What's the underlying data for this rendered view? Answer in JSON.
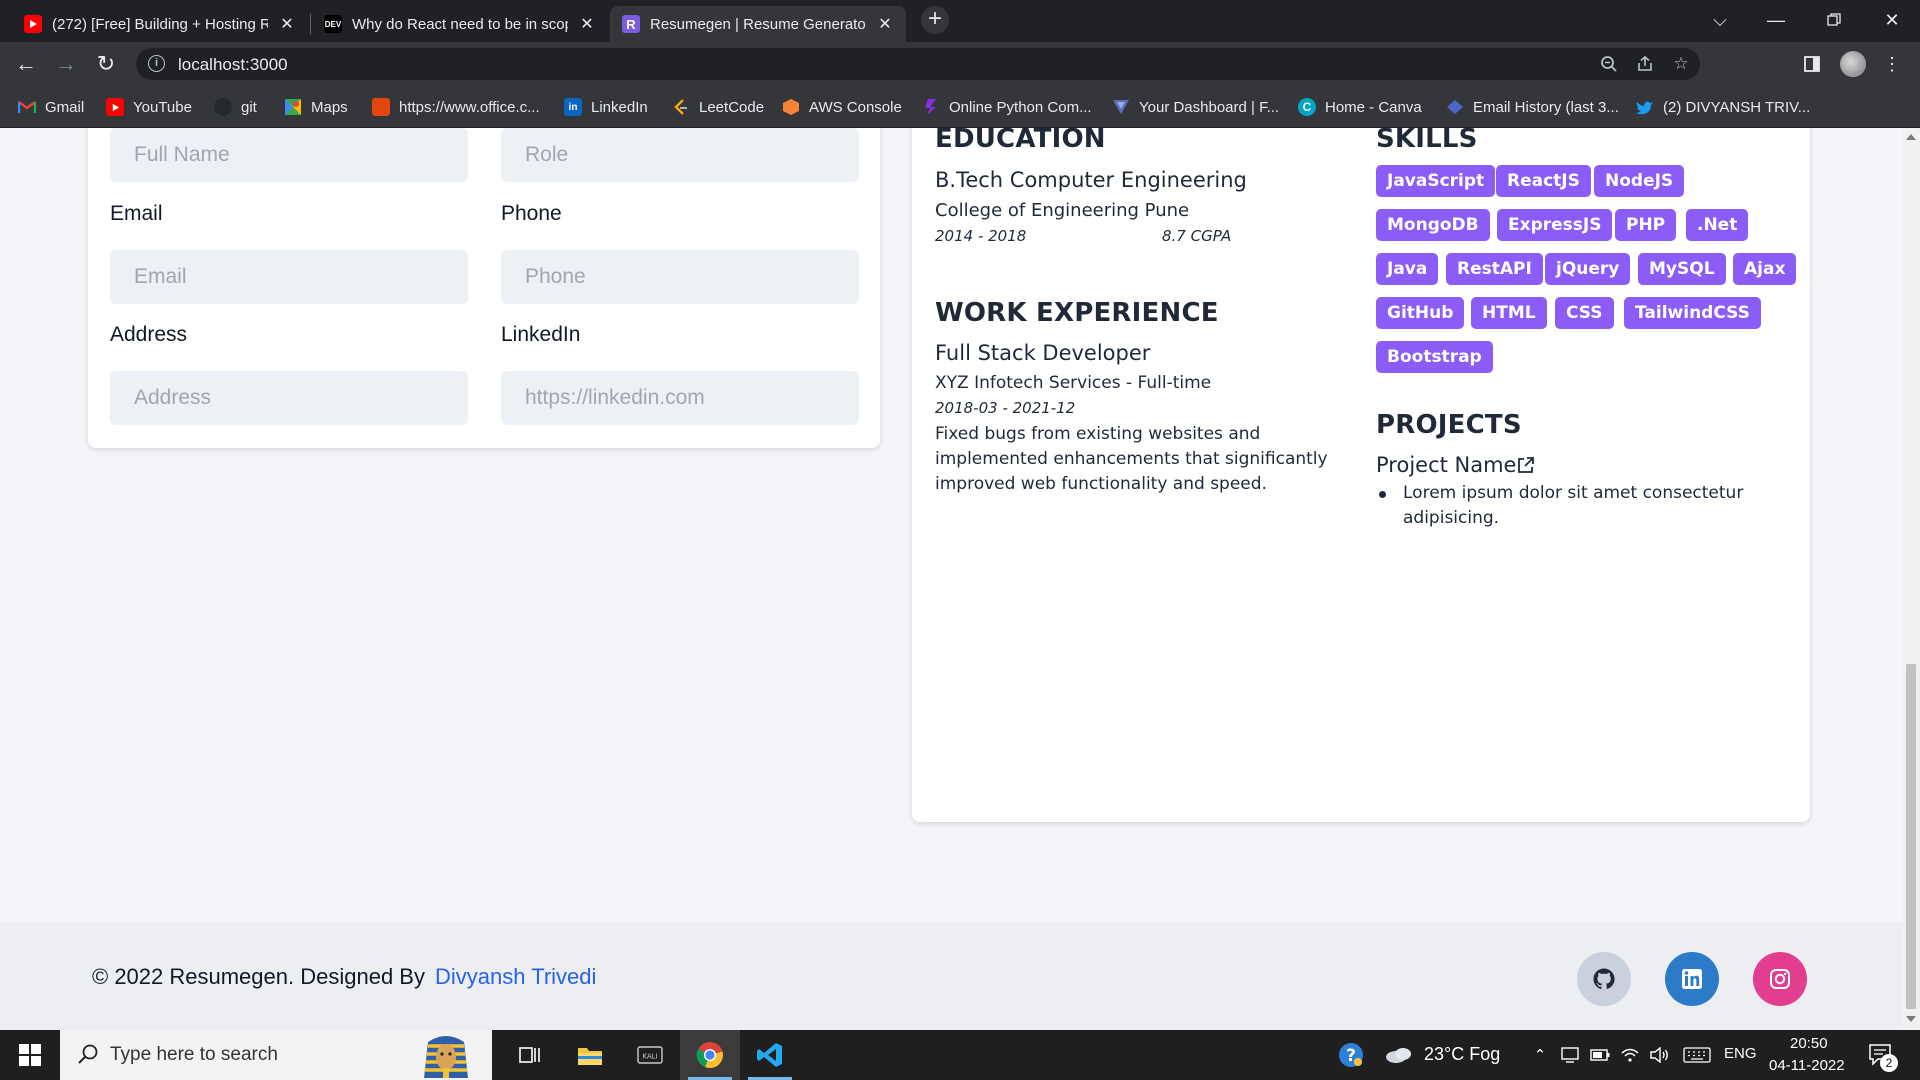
{
  "browser": {
    "tabs": [
      {
        "title": "(272) [Free] Building + Hosting R",
        "icon": "youtube-icon"
      },
      {
        "title": "Why do React need to be in scop",
        "icon": "dev-icon"
      },
      {
        "title": "Resumegen | Resume Generator",
        "icon": "resumegen-icon"
      }
    ],
    "url": "localhost:3000",
    "bookmarks": [
      {
        "label": "Gmail",
        "icon": "gmail-icon"
      },
      {
        "label": "YouTube",
        "icon": "youtube-icon"
      },
      {
        "label": "git",
        "icon": "github-icon"
      },
      {
        "label": "Maps",
        "icon": "maps-icon"
      },
      {
        "label": "https://www.office.c...",
        "icon": "office-icon"
      },
      {
        "label": "LinkedIn",
        "icon": "linkedin-icon"
      },
      {
        "label": "LeetCode",
        "icon": "leetcode-icon"
      },
      {
        "label": "AWS Console",
        "icon": "aws-icon"
      },
      {
        "label": "Online Python Com...",
        "icon": "python-icon"
      },
      {
        "label": "Your Dashboard | F...",
        "icon": "dashboard-icon"
      },
      {
        "label": "Home - Canva",
        "icon": "canva-icon"
      },
      {
        "label": "Email History (last 3...",
        "icon": "email-icon"
      },
      {
        "label": "(2) DIVYANSH TRIV...",
        "icon": "twitter-icon"
      }
    ]
  },
  "form": {
    "fullname_placeholder": "Full Name",
    "role_placeholder": "Role",
    "email_label": "Email",
    "email_placeholder": "Email",
    "phone_label": "Phone",
    "phone_placeholder": "Phone",
    "address_label": "Address",
    "address_placeholder": "Address",
    "linkedin_label": "LinkedIn",
    "linkedin_placeholder": "https://linkedin.com"
  },
  "resume": {
    "education": {
      "title": "EDUCATION",
      "degree": "B.Tech Computer Engineering",
      "college": "College of Engineering Pune",
      "years": "2014 - 2018",
      "grade": "8.7 CGPA"
    },
    "experience": {
      "title": "WORK EXPERIENCE",
      "role": "Full Stack Developer",
      "company": "XYZ Infotech Services - Full-time",
      "period": "2018-03 - 2021-12",
      "description_lines": [
        "Fixed bugs from existing websites and",
        "implemented enhancements that significantly",
        "improved web functionality and speed."
      ]
    },
    "skills": {
      "title": "SKILLS",
      "items": [
        "JavaScript",
        "ReactJS",
        "NodeJS",
        "MongoDB",
        "ExpressJS",
        "PHP",
        ".Net",
        "Java",
        "RestAPI",
        "jQuery",
        "MySQL",
        "Ajax",
        "GitHub",
        "HTML",
        "CSS",
        "TailwindCSS",
        "Bootstrap"
      ]
    },
    "projects": {
      "title": "PROJECTS",
      "name": "Project Name",
      "bullet_lines": [
        "Lorem ipsum dolor sit amet consectetur",
        "adipisicing."
      ]
    }
  },
  "footer": {
    "copyright": "© 2022 Resumegen. Designed By",
    "author": "Divyansh Trivedi",
    "social": [
      "github-icon",
      "linkedin-icon",
      "instagram-icon"
    ]
  },
  "taskbar": {
    "search_placeholder": "Type here to search",
    "weather": "23°C  Fog",
    "language": "ENG",
    "time": "20:50",
    "date": "04-11-2022",
    "notifications": "2"
  },
  "colors": {
    "accent": "#8b5cf6",
    "link": "#2563eb",
    "linkedin": "#2b7bc8",
    "instagram": "#e23d8f",
    "github_bg": "#c9d1dc"
  }
}
